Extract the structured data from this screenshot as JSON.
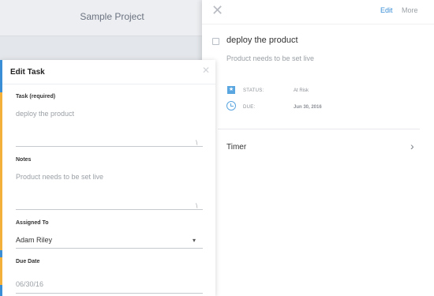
{
  "app": {
    "project_title": "Sample Project"
  },
  "detail": {
    "close_icon": "close-icon",
    "edit_label": "Edit",
    "more_label": "More",
    "task_title": "deploy the product",
    "task_notes": "Product needs to be set live",
    "status_label": "STATUS:",
    "status_value": "At Risk",
    "due_label": "DUE:",
    "due_value": "Jun 30, 2016",
    "timer_label": "Timer",
    "accent_color": "#3a8ed6"
  },
  "modal": {
    "title": "Edit Task",
    "task_label": "Task (required)",
    "task_value": "deploy the product",
    "notes_label": "Notes",
    "notes_value": "Product needs to be set live",
    "assigned_label": "Assigned To",
    "assigned_value": "Adam Riley",
    "due_label": "Due Date",
    "due_value": "06/30/16",
    "accent_color": "#f3b13c"
  }
}
